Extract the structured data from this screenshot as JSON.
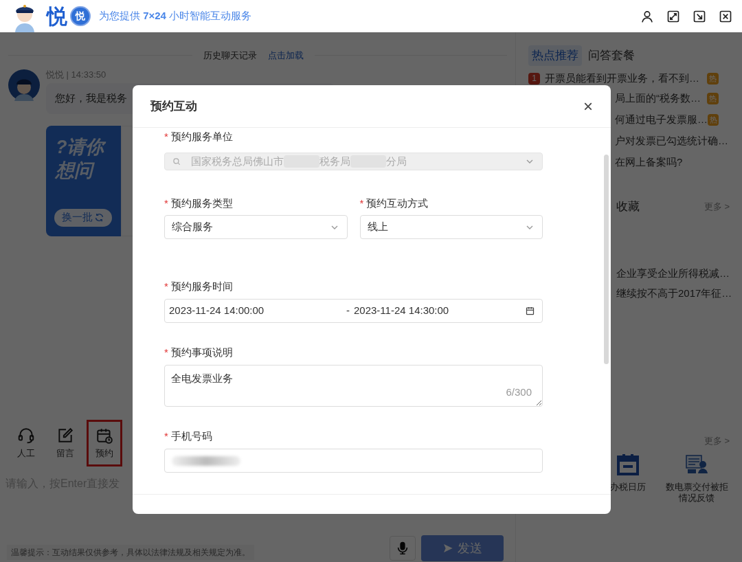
{
  "header": {
    "logo": "悦",
    "logo_badge": "悦",
    "slogan": "为您提供 **7×24** 小时智能互动服务"
  },
  "chat": {
    "history_label": "历史聊天记录",
    "load_link": "点击加载",
    "sender": "悦悦 | 14:33:50",
    "message": "您好，我是税务",
    "card": {
      "title_lines": [
        "?请你",
        "想问"
      ],
      "refresh": "换一批"
    }
  },
  "tools": [
    {
      "label": "人工",
      "kind": "headset",
      "highlighted": false
    },
    {
      "label": "留言",
      "kind": "note",
      "highlighted": false
    },
    {
      "label": "预约",
      "kind": "calendar",
      "highlighted": true
    }
  ],
  "input": {
    "placeholder": "请输入，按Enter直接发"
  },
  "tip": "温馨提示：互动结果仅供参考，具体以法律法规及相关规定为准。",
  "send": {
    "label": "发送",
    "disabled": true
  },
  "side": {
    "tabs": [
      {
        "label": "热点推荐",
        "selected": true
      },
      {
        "label": "问答套餐",
        "selected": false
      }
    ],
    "hot": [
      {
        "rank": "1",
        "text": "开票员能看到开票业务，看不到…",
        "badge": "热"
      },
      {
        "text": "局上面的“税务数…",
        "badge": "热"
      },
      {
        "text": "何通过电子发票服…",
        "badge": "热"
      },
      {
        "text": "户对发票已勾选统计确…"
      },
      {
        "text": "在网上备案吗?"
      }
    ],
    "favorites": {
      "title": "收藏",
      "more": "更多 >",
      "items": [
        "企业享受企业所得税减…",
        "继续按不高于2017年征…"
      ]
    },
    "apps": {
      "more": "更多 >",
      "items": [
        {
          "label": "办税日历",
          "kind": "calendar"
        },
        {
          "label": "数电票交付被拒情况反馈",
          "kind": "ticket"
        }
      ]
    }
  },
  "modal": {
    "title": "预约互动",
    "close": "×",
    "fields": [
      {
        "kind": "unit",
        "mark": "*",
        "label": "预约服务单位",
        "parts": [
          "国家税务总局佛山市",
          "税务局",
          "分局"
        ]
      },
      {
        "kind": "pair",
        "items": [
          {
            "mark": "*",
            "label": "预约服务类型",
            "value": "综合服务"
          },
          {
            "mark": "*",
            "label": "预约互动方式",
            "value": "线上"
          }
        ]
      },
      {
        "kind": "range",
        "mark": "*",
        "label": "预约服务时间",
        "start": "2023-11-24 14:00:00",
        "separator": "-",
        "end": "2023-11-24 14:30:00"
      },
      {
        "kind": "textarea",
        "mark": "*",
        "label": "预约事项说明",
        "value": "全电发票业务",
        "counter": "6/300"
      },
      {
        "kind": "phone",
        "mark": "*",
        "label": "手机号码"
      }
    ]
  }
}
